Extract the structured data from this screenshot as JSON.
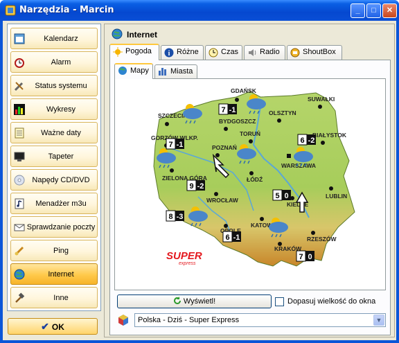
{
  "window": {
    "title": "Narzędzia - Marcin",
    "buttons": [
      "minimize",
      "maximize",
      "close"
    ]
  },
  "sidebar": {
    "items": [
      {
        "label": "Kalendarz",
        "icon": "calendar-icon"
      },
      {
        "label": "Alarm",
        "icon": "alarm-clock-icon"
      },
      {
        "label": "Status systemu",
        "icon": "tools-icon"
      },
      {
        "label": "Wykresy",
        "icon": "bar-chart-icon"
      },
      {
        "label": "Ważne daty",
        "icon": "notepad-icon"
      },
      {
        "label": "Tapeter",
        "icon": "monitor-icon"
      },
      {
        "label": "Napędy CD/DVD",
        "icon": "cd-icon"
      },
      {
        "label": "Menadżer m3u",
        "icon": "playlist-icon"
      },
      {
        "label": "Sprawdzanie poczty",
        "icon": "envelope-icon"
      },
      {
        "label": "Ping",
        "icon": "ping-icon"
      },
      {
        "label": "Internet",
        "icon": "globe-icon",
        "active": true
      },
      {
        "label": "Inne",
        "icon": "hammer-icon"
      }
    ],
    "ok_label": "OK"
  },
  "main": {
    "title": "Internet",
    "tabs": [
      {
        "label": "Pogoda",
        "active": true
      },
      {
        "label": "Różne"
      },
      {
        "label": "Czas"
      },
      {
        "label": "Radio"
      },
      {
        "label": "ShoutBox"
      }
    ],
    "subtabs": [
      {
        "label": "Mapy",
        "active": true
      },
      {
        "label": "Miasta"
      }
    ],
    "map": {
      "cities": [
        "GDAŃSK",
        "SUWAŁKI",
        "SZCZECIN",
        "OLSZTYN",
        "BYDGOSZCZ",
        "TORUŃ",
        "BIAŁYSTOK",
        "GORZÓW WLKP.",
        "POZNAŃ",
        "WARSZAWA",
        "ZIELONA GÓRA",
        "ŁÓDŹ",
        "LUBLIN",
        "WROCŁAW",
        "KIELCE",
        "OPOLE",
        "KATOWICE",
        "RZESZÓW",
        "KRAKÓW"
      ],
      "temps": [
        {
          "day": "7",
          "night": "-1"
        },
        {
          "day": "6",
          "night": "-2"
        },
        {
          "day": "7",
          "night": "-1"
        },
        {
          "day": "9",
          "night": "-2"
        },
        {
          "day": "5",
          "night": "0"
        },
        {
          "day": "8",
          "night": "-3"
        },
        {
          "day": "6",
          "night": "-1"
        },
        {
          "day": "7",
          "night": "0"
        }
      ],
      "logo": {
        "main": "SUPER",
        "sub": "express"
      }
    },
    "show_button": "Wyświetl!",
    "fit_checkbox": {
      "label": "Dopasuj wielkość do okna",
      "checked": false
    },
    "source_select": "Polska - Dziś - Super Express"
  }
}
